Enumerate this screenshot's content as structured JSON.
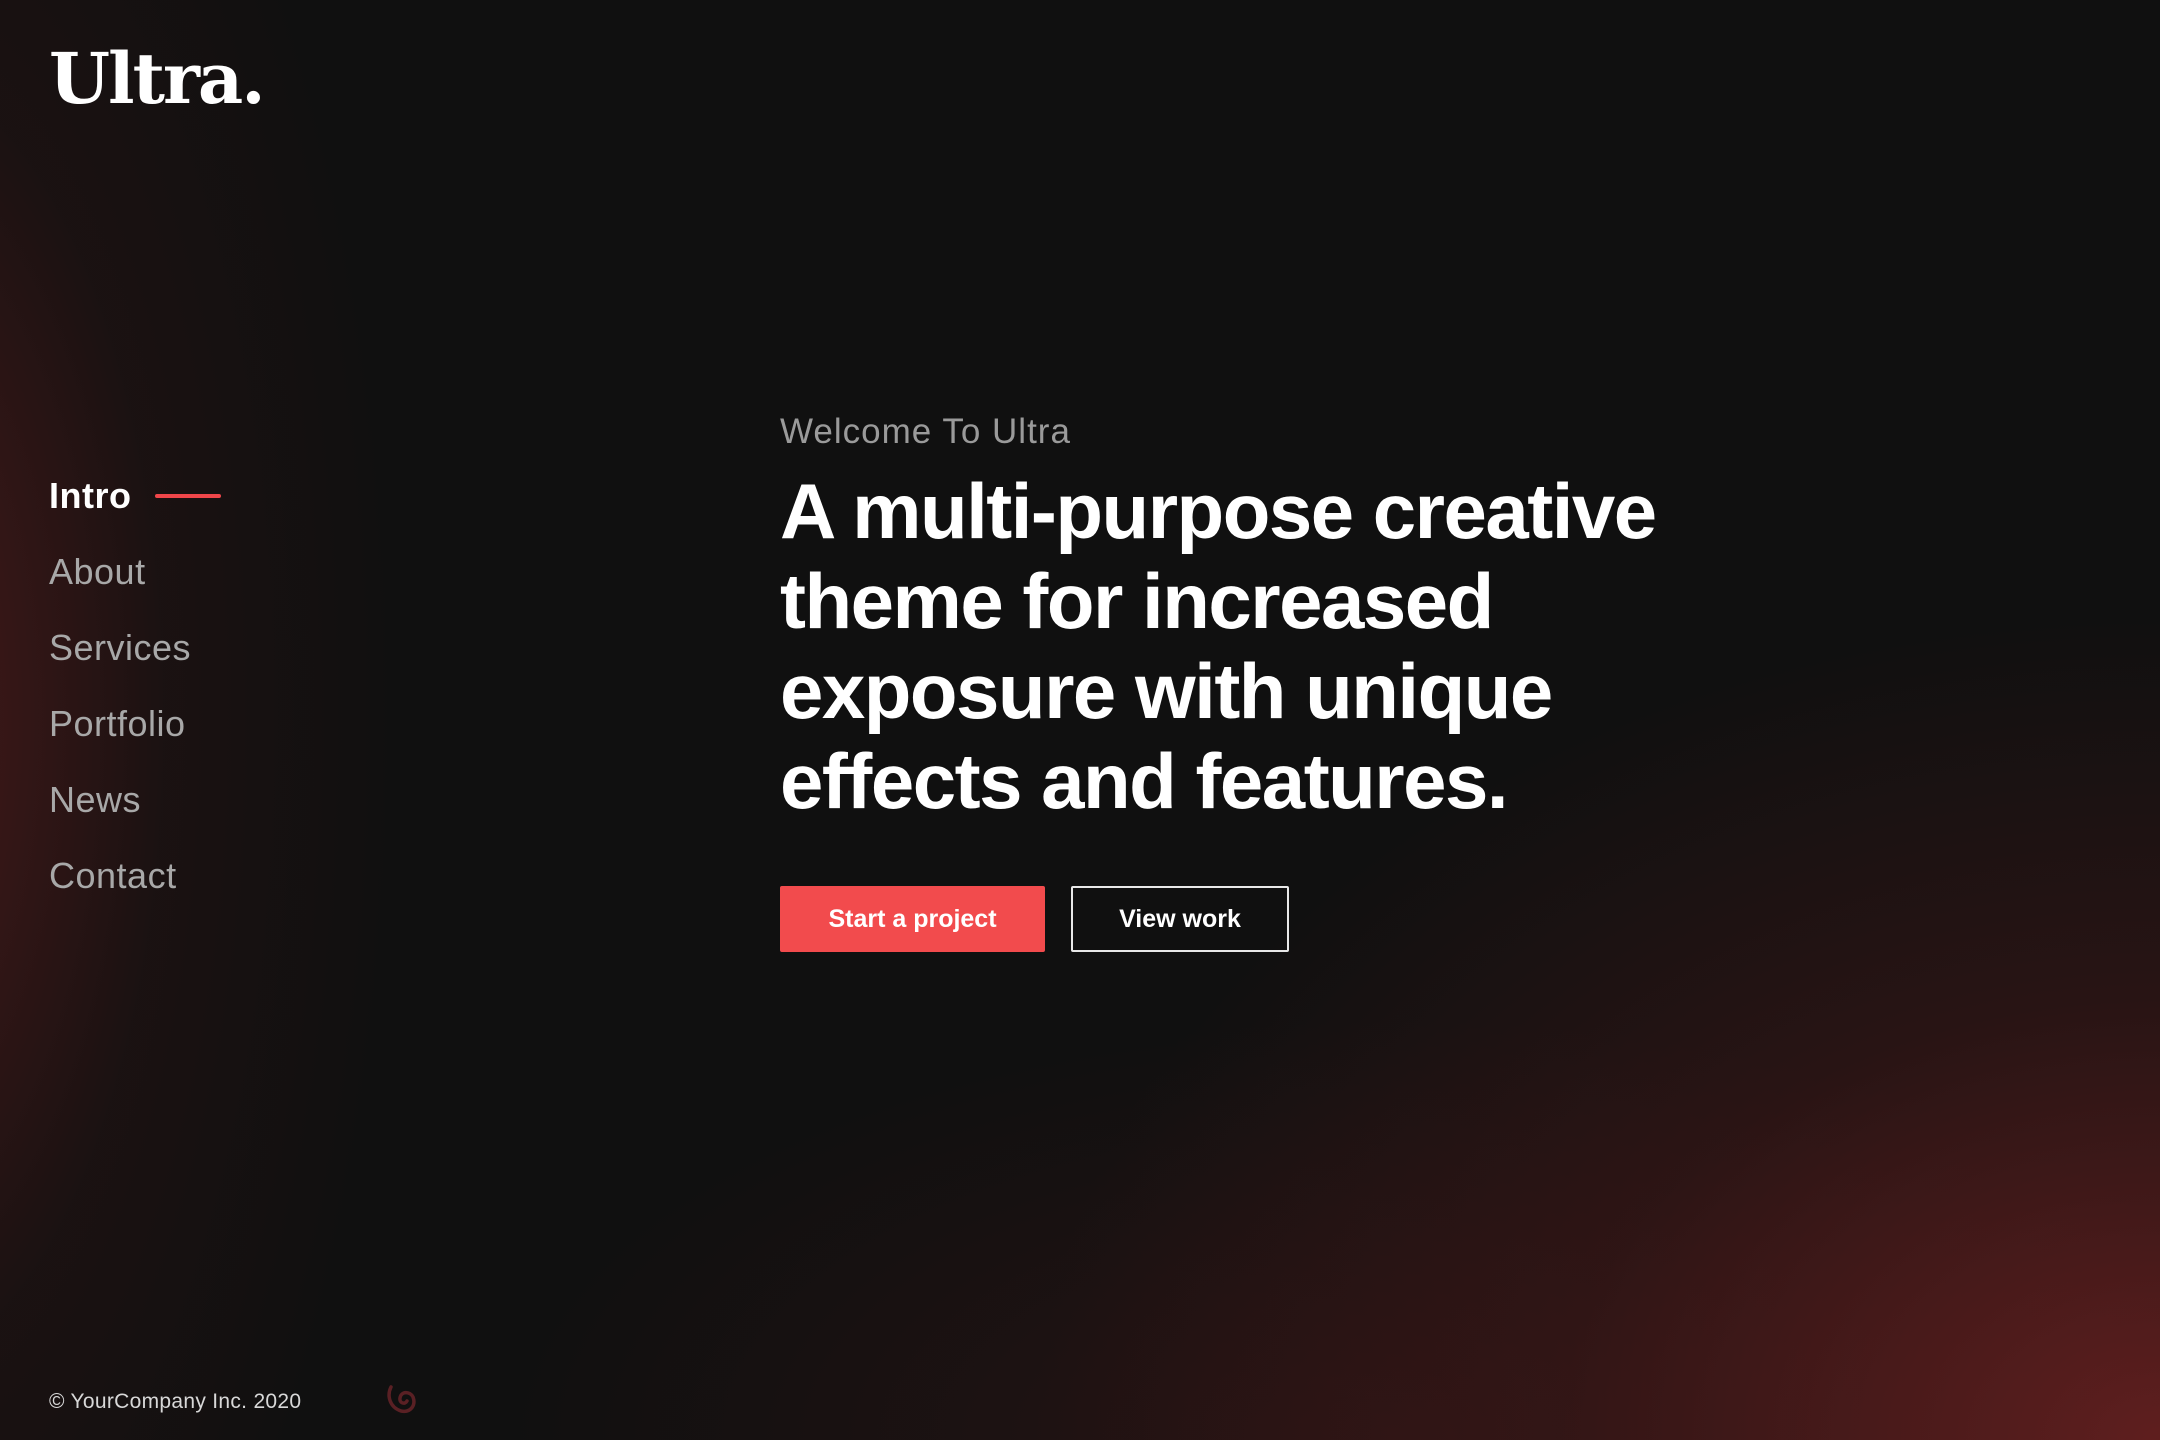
{
  "brand": {
    "logo_text": "Ultra."
  },
  "nav": {
    "items": [
      {
        "label": "Intro",
        "active": true
      },
      {
        "label": "About",
        "active": false
      },
      {
        "label": "Services",
        "active": false
      },
      {
        "label": "Portfolio",
        "active": false
      },
      {
        "label": "News",
        "active": false
      },
      {
        "label": "Contact",
        "active": false
      }
    ]
  },
  "hero": {
    "eyebrow": "Welcome To Ultra",
    "headline_lines": [
      "A multi-purpose creative",
      "theme for increased",
      "exposure with unique",
      "effects and features."
    ],
    "primary_button": "Start a project",
    "secondary_button": "View work"
  },
  "footer": {
    "copyright": "© YourCompany Inc. 2020"
  },
  "colors": {
    "accent": "#f24b4d",
    "background": "#101010",
    "text_primary": "#ffffff",
    "text_muted": "#a8a8a8"
  },
  "icons": {
    "brand_mark": "swirl-logo-icon"
  }
}
